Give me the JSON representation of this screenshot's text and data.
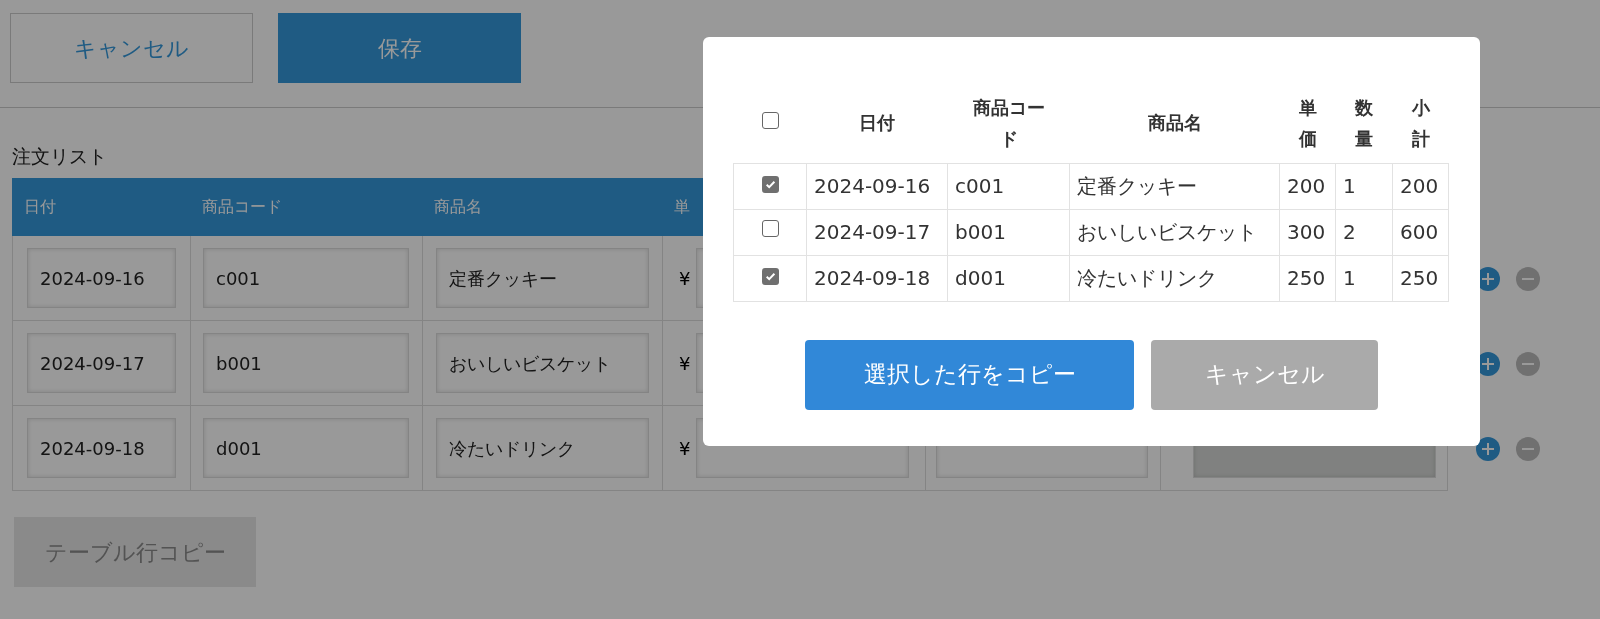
{
  "toolbar": {
    "buttons": [
      {
        "label": "キャンセル",
        "kind": "outline"
      },
      {
        "label": "保存",
        "kind": "primary"
      }
    ]
  },
  "order_list": {
    "title": "注文リスト",
    "columns": [
      "日付",
      "商品コード",
      "商品名",
      "単"
    ],
    "rows": [
      {
        "date": "2024-09-16",
        "code": "c001",
        "name": "定番クッキー",
        "currency": "¥"
      },
      {
        "date": "2024-09-17",
        "code": "b001",
        "name": "おいしいビスケット",
        "currency": "¥"
      },
      {
        "date": "2024-09-18",
        "code": "d001",
        "name": "冷たいドリンク",
        "currency": "¥"
      }
    ],
    "copy_button": {
      "label": "テーブル行コピー",
      "disabled": true
    }
  },
  "dialog": {
    "select_all": {
      "checked": false
    },
    "columns": [
      "日付",
      "商品コード",
      "商品名",
      "単価",
      "数量",
      "小計"
    ],
    "rows": [
      {
        "checked": true,
        "cells": [
          "2024-09-16",
          "c001",
          "定番クッキー",
          "200",
          "1",
          "200"
        ]
      },
      {
        "checked": false,
        "cells": [
          "2024-09-17",
          "b001",
          "おいしいビスケット",
          "300",
          "2",
          "600"
        ]
      },
      {
        "checked": true,
        "cells": [
          "2024-09-18",
          "d001",
          "冷たいドリンク",
          "250",
          "1",
          "250"
        ]
      }
    ],
    "buttons": [
      {
        "label": "選択した行をコピー",
        "kind": "primary"
      },
      {
        "label": "キャンセル",
        "kind": "secondary"
      }
    ]
  }
}
